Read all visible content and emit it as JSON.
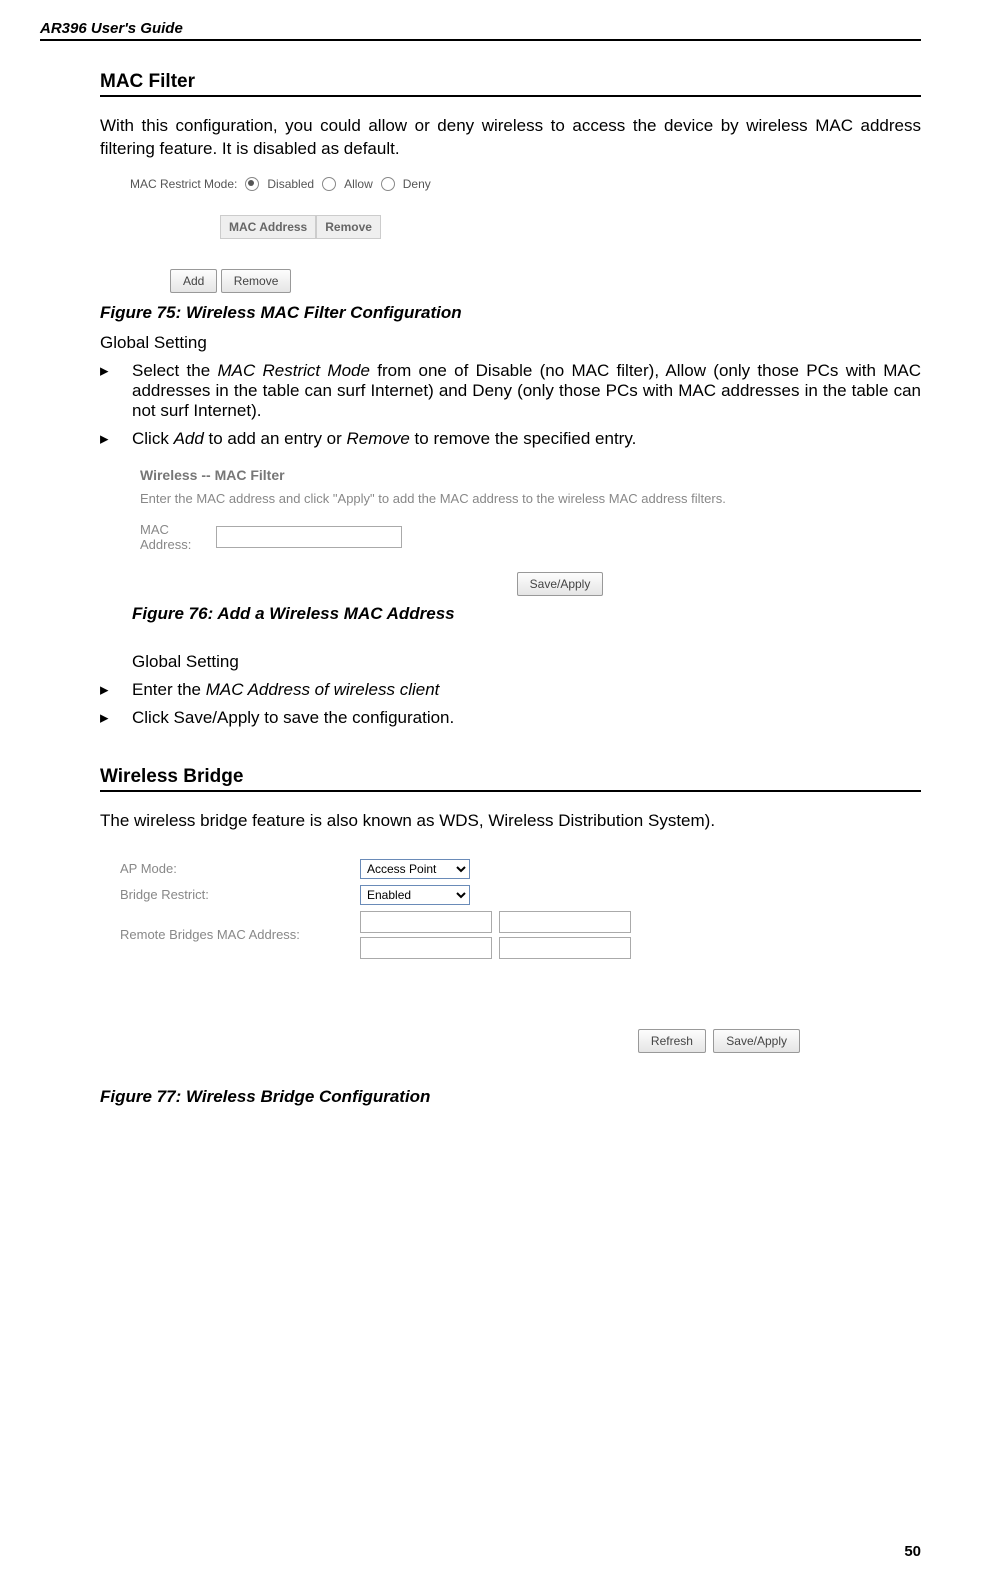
{
  "header": {
    "title": "AR396 User's Guide"
  },
  "section1": {
    "title": "MAC Filter",
    "intro": "With this configuration, you could allow or deny wireless to access the device by wireless MAC address filtering feature. It is disabled as default."
  },
  "fig75": {
    "caption": "Figure 75: Wireless MAC Filter Configuration",
    "mode_label": "MAC Restrict Mode:",
    "opt_disabled": "Disabled",
    "opt_allow": "Allow",
    "opt_deny": "Deny",
    "th_mac": "MAC Address",
    "th_remove": "Remove",
    "btn_add": "Add",
    "btn_remove": "Remove"
  },
  "gs1": {
    "label": "Global Setting",
    "b1_pre": "Select the ",
    "b1_i": "MAC Restrict Mode",
    "b1_post": " from one of Disable (no MAC filter), Allow (only those PCs with MAC addresses in the table can surf Internet) and Deny (only those PCs with MAC addresses in the table can not surf Internet).",
    "b2_pre": "Click ",
    "b2_i1": "Add",
    "b2_mid": " to add an entry or ",
    "b2_i2": "Remove",
    "b2_post": " to remove the specified entry."
  },
  "fig76": {
    "caption": "Figure 76: Add a Wireless MAC Address",
    "title": "Wireless -- MAC Filter",
    "desc": "Enter the MAC address and click \"Apply\" to add the MAC address to the wireless MAC address filters.",
    "mac_label": "MAC Address:",
    "save_btn": "Save/Apply"
  },
  "gs2": {
    "label": "Global Setting",
    "b1_pre": "Enter the ",
    "b1_i": "MAC Address of wireless client",
    "b2": "Click Save/Apply to save the configuration."
  },
  "section2": {
    "title": "Wireless Bridge",
    "intro": "The wireless bridge feature is also known as WDS, Wireless Distribution System)."
  },
  "fig77": {
    "caption": "Figure 77: Wireless Bridge Configuration",
    "ap_mode_label": "AP Mode:",
    "ap_mode_value": "Access Point",
    "bridge_restrict_label": "Bridge Restrict:",
    "bridge_restrict_value": "Enabled",
    "remote_label": "Remote Bridges MAC Address:",
    "btn_refresh": "Refresh",
    "btn_save": "Save/Apply"
  },
  "page_number": "50"
}
